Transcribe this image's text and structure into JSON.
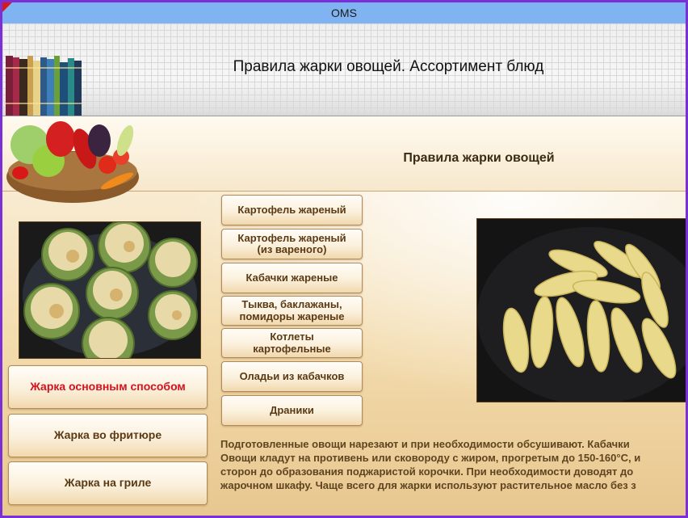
{
  "window": {
    "title": "OMS"
  },
  "header": {
    "title": "Правила жарки овощей. Ассортимент блюд"
  },
  "section": {
    "title": "Правила жарки овощей"
  },
  "left_nav": [
    {
      "label": "Жарка основным способом",
      "active": true
    },
    {
      "label": "Жарка во фритюре",
      "active": false
    },
    {
      "label": "Жарка на гриле",
      "active": false
    }
  ],
  "dishes": [
    {
      "line1": "Картофель жареный",
      "line2": ""
    },
    {
      "line1": "Картофель жареный",
      "line2": "(из вареного)"
    },
    {
      "line1": "Кабачки жареные",
      "line2": ""
    },
    {
      "line1": "Тыква, баклажаны,",
      "line2": "помидоры жареные"
    },
    {
      "line1": "Котлеты",
      "line2": "картофельные"
    },
    {
      "line1": "Оладьи из кабачков",
      "line2": ""
    },
    {
      "line1": "Драники",
      "line2": ""
    }
  ],
  "description": {
    "lines": [
      "Подготовленные овощи нарезают и при необходимости обсушивают. Кабачки",
      "Овощи кладут на противень или сковороду с жиром, прогретым до 150-160°С, и",
      "сторон до образования поджаристой корочки. При необходимости доводят до",
      "жарочном шкафу. Чаще всего для жарки используют растительное масло без з"
    ]
  },
  "colors": {
    "accent_active": "#d4121e",
    "frame": "#7b2fd6",
    "titlebar": "#7fb3f1"
  }
}
